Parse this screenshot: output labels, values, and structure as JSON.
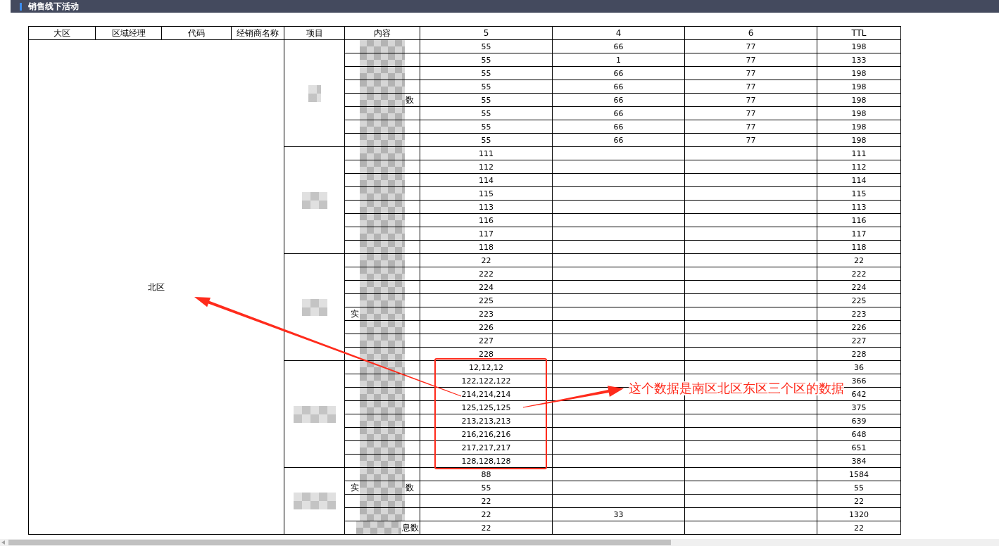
{
  "header_bar": {
    "title": "销售线下活动"
  },
  "table": {
    "columns": [
      "大区",
      "区域经理",
      "代码",
      "经销商名称",
      "项目",
      "内容",
      "5",
      "4",
      "6",
      "TTL"
    ],
    "region": "北区",
    "groups": [
      {
        "rows": [
          {
            "col_5": "55",
            "col_4": "66",
            "col_6": "77",
            "ttl": "198"
          },
          {
            "col_5": "55",
            "col_4": "1",
            "col_6": "77",
            "ttl": "133"
          },
          {
            "col_5": "55",
            "col_4": "66",
            "col_6": "77",
            "ttl": "198"
          },
          {
            "col_5": "55",
            "col_4": "66",
            "col_6": "77",
            "ttl": "198"
          },
          {
            "content_right": "数",
            "col_5": "55",
            "col_4": "66",
            "col_6": "77",
            "ttl": "198"
          },
          {
            "col_5": "55",
            "col_4": "66",
            "col_6": "77",
            "ttl": "198"
          },
          {
            "col_5": "55",
            "col_4": "66",
            "col_6": "77",
            "ttl": "198"
          },
          {
            "col_5": "55",
            "col_4": "66",
            "col_6": "77",
            "ttl": "198"
          }
        ]
      },
      {
        "rows": [
          {
            "col_5": "111",
            "ttl": "111"
          },
          {
            "col_5": "112",
            "ttl": "112"
          },
          {
            "col_5": "114",
            "ttl": "114"
          },
          {
            "col_5": "115",
            "ttl": "115"
          },
          {
            "col_5": "113",
            "ttl": "113"
          },
          {
            "col_5": "116",
            "ttl": "116"
          },
          {
            "col_5": "117",
            "ttl": "117"
          },
          {
            "col_5": "118",
            "ttl": "118"
          }
        ]
      },
      {
        "rows": [
          {
            "col_5": "22",
            "ttl": "22"
          },
          {
            "col_5": "222",
            "ttl": "222"
          },
          {
            "col_5": "224",
            "ttl": "224"
          },
          {
            "col_5": "225",
            "ttl": "225"
          },
          {
            "content_left": "实",
            "col_5": "223",
            "ttl": "223"
          },
          {
            "col_5": "226",
            "ttl": "226"
          },
          {
            "col_5": "227",
            "ttl": "227"
          },
          {
            "col_5": "228",
            "ttl": "228"
          }
        ]
      },
      {
        "rows": [
          {
            "col_5": "12,12,12",
            "ttl": "36"
          },
          {
            "col_5": "122,122,122",
            "ttl": "366"
          },
          {
            "col_5": "214,214,214",
            "ttl": "642"
          },
          {
            "col_5": "125,125,125",
            "ttl": "375"
          },
          {
            "col_5": "213,213,213",
            "ttl": "639"
          },
          {
            "col_5": "216,216,216",
            "ttl": "648"
          },
          {
            "col_5": "217,217,217",
            "ttl": "651"
          },
          {
            "col_5": "128,128,128",
            "ttl": "384"
          }
        ]
      },
      {
        "rows": [
          {
            "col_5": "88",
            "ttl": "1584"
          },
          {
            "content_left": "实",
            "content_right": "数",
            "col_5": "55",
            "ttl": "55"
          },
          {
            "col_5": "22",
            "ttl": "22"
          },
          {
            "col_5": "22",
            "col_4": "33",
            "ttl": "1320"
          },
          {
            "content_right": "息数",
            "col_5": "22",
            "ttl": "22"
          }
        ]
      }
    ]
  },
  "annotation": {
    "note": "这个数据是南区北区东区三个区的数据"
  }
}
